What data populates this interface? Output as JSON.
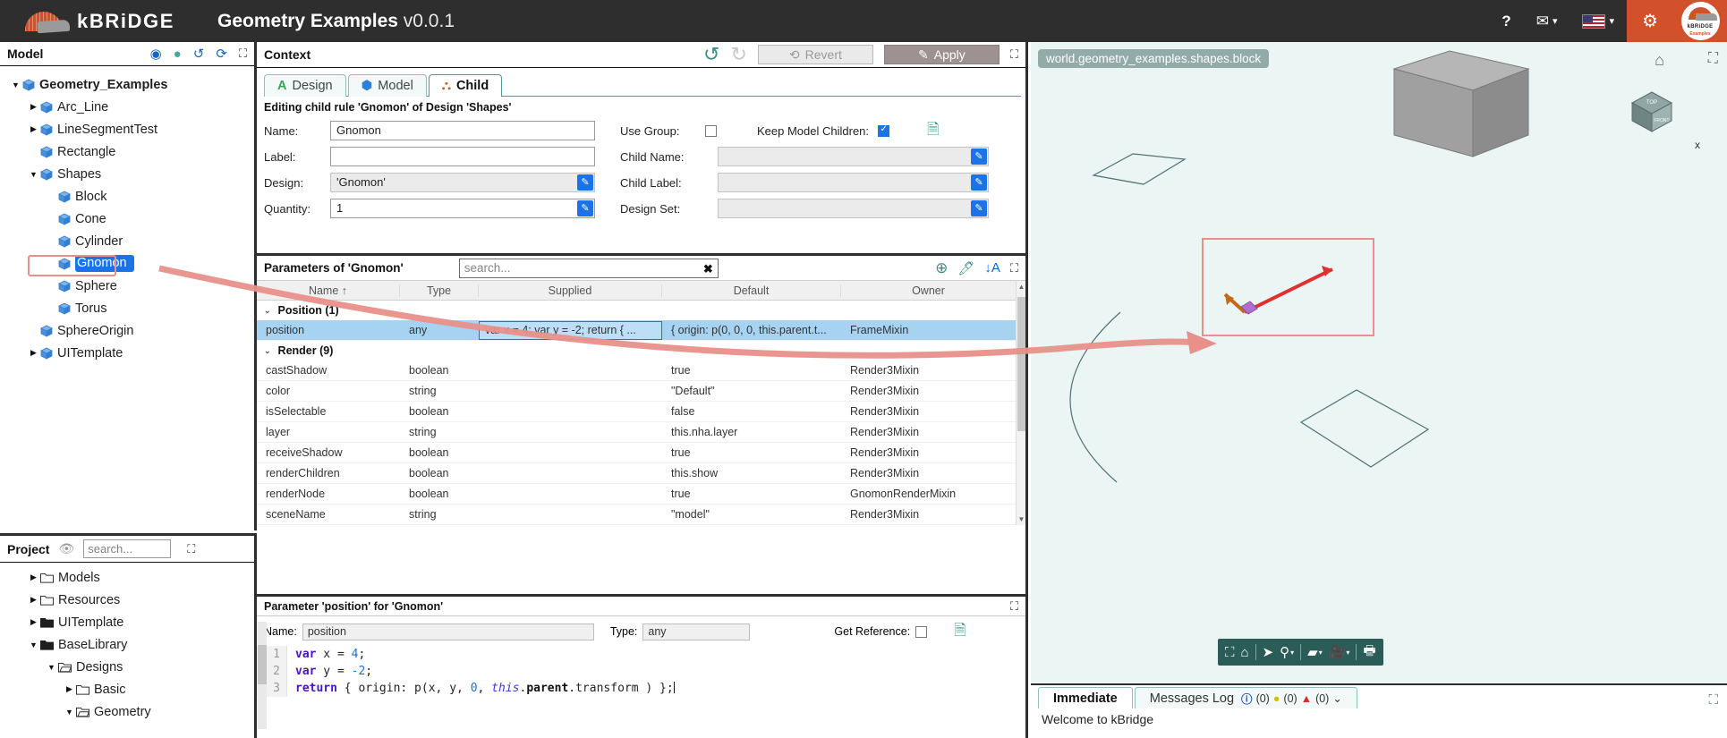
{
  "app": {
    "brand_k": "k",
    "brand_rest": "BRiDGE",
    "title": "Geometry Examples",
    "version": "v0.0.1",
    "help_icon": "question-mark-icon",
    "mail_icon": "envelope-icon",
    "flag_icon": "us-flag-icon",
    "gear_icon": "gear-icon",
    "avatar_line1": "kBRiDGE",
    "avatar_line2": "Examples"
  },
  "model_panel": {
    "title": "Model",
    "icons": [
      "play-icon",
      "status-dot-icon",
      "history-icon",
      "refresh-icon",
      "expand-icon"
    ],
    "tree": [
      {
        "label": "Geometry_Examples",
        "depth": 0,
        "twisty": "down",
        "bold": true,
        "selected": false
      },
      {
        "label": "Arc_Line",
        "depth": 1,
        "twisty": "right",
        "bold": false,
        "selected": false
      },
      {
        "label": "LineSegmentTest",
        "depth": 1,
        "twisty": "right",
        "bold": false,
        "selected": false
      },
      {
        "label": "Rectangle",
        "depth": 1,
        "twisty": "none",
        "bold": false,
        "selected": false
      },
      {
        "label": "Shapes",
        "depth": 1,
        "twisty": "down",
        "bold": false,
        "selected": false
      },
      {
        "label": "Block",
        "depth": 2,
        "twisty": "none",
        "bold": false,
        "selected": false
      },
      {
        "label": "Cone",
        "depth": 2,
        "twisty": "none",
        "bold": false,
        "selected": false
      },
      {
        "label": "Cylinder",
        "depth": 2,
        "twisty": "none",
        "bold": false,
        "selected": false
      },
      {
        "label": "Gnomon",
        "depth": 2,
        "twisty": "none",
        "bold": false,
        "selected": true
      },
      {
        "label": "Sphere",
        "depth": 2,
        "twisty": "none",
        "bold": false,
        "selected": false
      },
      {
        "label": "Torus",
        "depth": 2,
        "twisty": "none",
        "bold": false,
        "selected": false
      },
      {
        "label": "SphereOrigin",
        "depth": 1,
        "twisty": "none",
        "bold": false,
        "selected": false
      },
      {
        "label": "UITemplate",
        "depth": 1,
        "twisty": "right",
        "bold": false,
        "selected": false
      }
    ]
  },
  "project_panel": {
    "title": "Project",
    "eye_icon": "eye-slash-icon",
    "search_placeholder": "search...",
    "search_value": "",
    "tree": [
      {
        "label": "Models",
        "depth": 1,
        "twisty": "right",
        "open": false
      },
      {
        "label": "Resources",
        "depth": 1,
        "twisty": "right",
        "open": false
      },
      {
        "label": "UITemplate",
        "depth": 1,
        "twisty": "right",
        "open": false,
        "filled": true
      },
      {
        "label": "BaseLibrary",
        "depth": 1,
        "twisty": "down",
        "open": true,
        "filled": true
      },
      {
        "label": "Designs",
        "depth": 2,
        "twisty": "down",
        "open": true
      },
      {
        "label": "Basic",
        "depth": 3,
        "twisty": "right",
        "open": false
      },
      {
        "label": "Geometry",
        "depth": 3,
        "twisty": "down",
        "open": true
      }
    ]
  },
  "context": {
    "title": "Context",
    "undo_icon": "undo-icon",
    "redo_icon": "redo-icon",
    "revert_label": "Revert",
    "apply_label": "Apply",
    "expand_icon": "expand-icon",
    "tabs": [
      {
        "label": "Design",
        "icon": "design-a-icon",
        "active": false
      },
      {
        "label": "Model",
        "icon": "cube-icon",
        "active": false
      },
      {
        "label": "Child",
        "icon": "hierarchy-icon",
        "active": true
      }
    ],
    "editing_note": "Editing child rule 'Gnomon' of Design 'Shapes'",
    "fields": {
      "name_label": "Name:",
      "name_value": "Gnomon",
      "label_label": "Label:",
      "label_value": "",
      "design_label": "Design:",
      "design_value": "'Gnomon'",
      "quantity_label": "Quantity:",
      "quantity_value": "1",
      "use_group_label": "Use Group:",
      "use_group_checked": false,
      "child_name_label": "Child Name:",
      "child_name_value": "",
      "child_label_label": "Child Label:",
      "child_label_value": "",
      "design_set_label": "Design Set:",
      "design_set_value": "",
      "keep_model_children_label": "Keep Model Children:",
      "keep_model_children_checked": true,
      "doc_icon": "document-icon"
    }
  },
  "parameters": {
    "title": "Parameters of 'Gnomon'",
    "search_placeholder": "search...",
    "search_value": "",
    "clear_icon": "clear-x-icon",
    "add_icon": "add-plus-icon",
    "erase_icon": "eraser-icon",
    "sort_icon": "sort-az-icon",
    "expand_icon": "expand-icon",
    "columns": [
      "Name ↑",
      "Type",
      "Supplied",
      "Default",
      "Owner"
    ],
    "groups": [
      {
        "label": "Position (1)",
        "rows": [
          {
            "name": "position",
            "type": "any",
            "supplied": "var x = 4; var y = -2; return { ...",
            "default": "{ origin: p(0, 0, 0, this.parent.t...",
            "owner": "FrameMixin",
            "selected": true
          }
        ]
      },
      {
        "label": "Render (9)",
        "rows": [
          {
            "name": "castShadow",
            "type": "boolean",
            "supplied": "",
            "default": "true",
            "owner": "Render3Mixin",
            "selected": false
          },
          {
            "name": "color",
            "type": "string",
            "supplied": "",
            "default": "\"Default\"",
            "owner": "Render3Mixin",
            "selected": false
          },
          {
            "name": "isSelectable",
            "type": "boolean",
            "supplied": "",
            "default": "false",
            "owner": "Render3Mixin",
            "selected": false
          },
          {
            "name": "layer",
            "type": "string",
            "supplied": "",
            "default": "this.nha.layer",
            "owner": "Render3Mixin",
            "selected": false
          },
          {
            "name": "receiveShadow",
            "type": "boolean",
            "supplied": "",
            "default": "true",
            "owner": "Render3Mixin",
            "selected": false
          },
          {
            "name": "renderChildren",
            "type": "boolean",
            "supplied": "",
            "default": "this.show",
            "owner": "Render3Mixin",
            "selected": false
          },
          {
            "name": "renderNode",
            "type": "boolean",
            "supplied": "",
            "default": "true",
            "owner": "GnomonRenderMixin",
            "selected": false
          },
          {
            "name": "sceneName",
            "type": "string",
            "supplied": "",
            "default": "\"model\"",
            "owner": "Render3Mixin",
            "selected": false
          }
        ]
      }
    ]
  },
  "param_editor": {
    "title": "Parameter 'position' for 'Gnomon'",
    "expand_icon": "expand-icon",
    "name_label": "Name:",
    "name_value": "position",
    "type_label": "Type:",
    "type_value": "any",
    "get_reference_label": "Get Reference:",
    "get_reference_checked": false,
    "doc_icon": "document-icon",
    "code_lines": [
      "1",
      "2",
      "3"
    ],
    "code": [
      "var x = 4;",
      "var y = -2;",
      "return { origin: p(x, y, 0, this.parent.transform ) };"
    ]
  },
  "viewport": {
    "chip_label": "world.geometry_examples.shapes.block",
    "home_icon": "home-icon",
    "expand_icon": "expand-icon",
    "axis_label_x": "x",
    "nav_cube_faces": [
      "TOP",
      "FRONT"
    ],
    "toolbar_icons": [
      "fit-all-icon",
      "home-icon",
      "select-arrow-icon",
      "pin-icon",
      "box-view-icon",
      "camera-icon",
      "print-icon"
    ],
    "highlight_color": "#e8908a"
  },
  "console": {
    "tabs": [
      {
        "label": "Immediate",
        "active": true
      },
      {
        "label": "Messages Log",
        "active": false
      }
    ],
    "badges": {
      "info": "(0)",
      "warn": "(0)",
      "error": "(0)"
    },
    "dropdown_icon": "chevron-down-icon",
    "expand_icon": "expand-icon",
    "welcome_line": "Welcome to kBridge"
  },
  "colors": {
    "brand_orange": "#d2502a",
    "topbar_dark": "#2e2e2e",
    "teal": "#3d8f86",
    "select_blue": "#1a73e8",
    "row_select": "#a7d3f3",
    "viewport_bg": "#eaf5f4",
    "annotation": "#e8908a"
  }
}
